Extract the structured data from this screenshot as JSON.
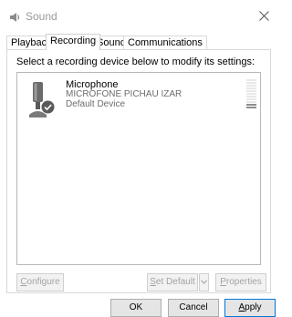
{
  "window": {
    "title": "Sound",
    "app_icon": "speaker-icon",
    "close_icon": "close-icon"
  },
  "tabs": [
    {
      "label": "Playback",
      "active": false
    },
    {
      "label": "Recording",
      "active": true
    },
    {
      "label": "Sounds",
      "active": false
    },
    {
      "label": "Communications",
      "active": false
    }
  ],
  "panel": {
    "instruction": "Select a recording device below to modify its settings:",
    "devices": [
      {
        "name": "Microphone",
        "description": "MICROFONE PICHAU IZAR",
        "status": "Default Device",
        "icon": "microphone-icon",
        "badge": "default-check-icon",
        "level": 0.15
      }
    ],
    "buttons": {
      "configure": {
        "label": "Configure",
        "mnemonic": "C",
        "rest": "onfigure",
        "enabled": false
      },
      "set_default": {
        "label": "Set Default",
        "mnemonic": "S",
        "rest": "et Default",
        "enabled": false
      },
      "set_default_dropdown": {
        "icon": "chevron-down-icon",
        "enabled": false
      },
      "properties": {
        "label": "Properties",
        "mnemonic": "P",
        "rest": "roperties",
        "enabled": false
      }
    }
  },
  "footer": {
    "ok": {
      "label": "OK"
    },
    "cancel": {
      "label": "Cancel"
    },
    "apply": {
      "label": "Apply",
      "mnemonic": "A",
      "rest": "pply"
    }
  },
  "colors": {
    "accent": "#0078d7",
    "check_badge": "#5a5a5a",
    "disabled_text": "#a3a3a3"
  }
}
